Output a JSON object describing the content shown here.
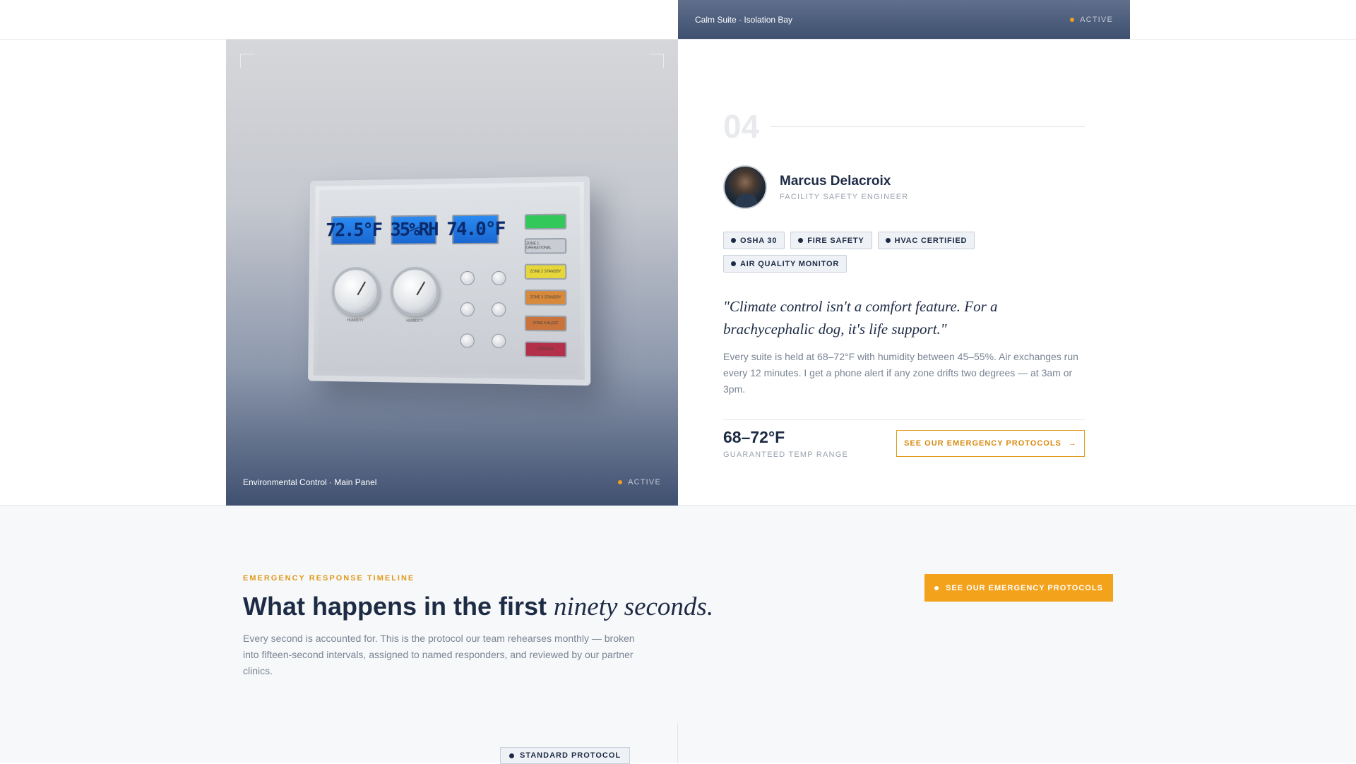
{
  "top_card": {
    "caption": "Calm Suite · Isolation Bay",
    "status": "ACTIVE"
  },
  "image_panel": {
    "caption": "Environmental Control · Main Panel",
    "status": "ACTIVE",
    "readouts": [
      "72.5°F",
      "35%RH",
      "74.0°F"
    ],
    "gauge_labels": [
      "HUMIDITY",
      "HUMIDITY"
    ],
    "lights": [
      "",
      "ZONE 1 OPERATIONAL",
      "ZONE 2 STANDBY",
      "ZONE 3 STANDBY",
      "ZONE 4 ALERT",
      "CRITICAL"
    ]
  },
  "profile": {
    "number": "04",
    "name": "Marcus Delacroix",
    "role": "FACILITY SAFETY ENGINEER",
    "tags": [
      "OSHA 30",
      "FIRE SAFETY",
      "HVAC CERTIFIED",
      "AIR QUALITY MONITOR"
    ],
    "quote": "\"Climate control isn't a comfort feature. For a brachycephalic dog, it's life support.\"",
    "body": "Every suite is held at 68–72°F with humidity between 45–55%. Air exchanges run every 12 minutes. I get a phone alert if any zone drifts two degrees — at 3am or 3pm.",
    "stat_value": "68–72°F",
    "stat_label": "GUARANTEED TEMP RANGE",
    "cta": "SEE OUR EMERGENCY PROTOCOLS",
    "cta_icon": "→"
  },
  "timeline": {
    "eyebrow": "EMERGENCY RESPONSE TIMELINE",
    "headline_main": "What happens in the first ",
    "headline_italic": "ninety seconds.",
    "lead": "Every second is accounted for. This is the protocol our team rehearses monthly — broken into fifteen-second intervals, assigned to named responders, and reviewed by our partner clinics.",
    "cta": "SEE OUR EMERGENCY PROTOCOLS",
    "badge": "STANDARD PROTOCOL"
  },
  "colors": {
    "accent": "#f3a21c",
    "navy": "#1d2b45",
    "muted": "#7a8494",
    "panel": "#3f5070"
  }
}
